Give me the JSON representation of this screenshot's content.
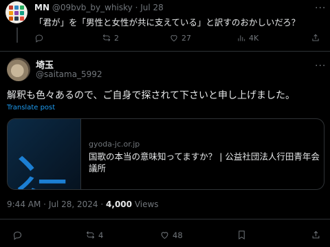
{
  "reply_parent": {
    "display_name": "MN",
    "handle": "@09bvb_by_whisky",
    "separator": "·",
    "date": "Jul 28",
    "text": "「君が」を「男性と女性が共に支えている」と訳すのおかしいだろ？",
    "more_label": "···",
    "actions": {
      "replies": "",
      "reposts": "2",
      "likes": "27",
      "views": "4K"
    }
  },
  "main_post": {
    "display_name": "埼玉",
    "handle": "@saitama_5992",
    "more_label": "···",
    "text": "解釈も色々あるので、ご自身で探されて下さいと申し上げました。",
    "translate_label": "Translate post",
    "link_card": {
      "domain": "gyoda-jc.or.jp",
      "title": "国歌の本当の意味知ってますか？ | 公益社団法人行田青年会議所",
      "thumbnail_text": "、行"
    },
    "meta": {
      "time": "9:44 AM",
      "dot": "·",
      "date": "Jul 28, 2024",
      "dot2": "·",
      "views": "4,000",
      "views_label": "Views"
    },
    "actions": {
      "replies": "",
      "reposts": "4",
      "likes": "48"
    }
  },
  "colors": {
    "background": "#000000",
    "text": "#e7e9ea",
    "muted": "#71767b",
    "link": "#1d9bf0",
    "border": "#2f3336"
  }
}
